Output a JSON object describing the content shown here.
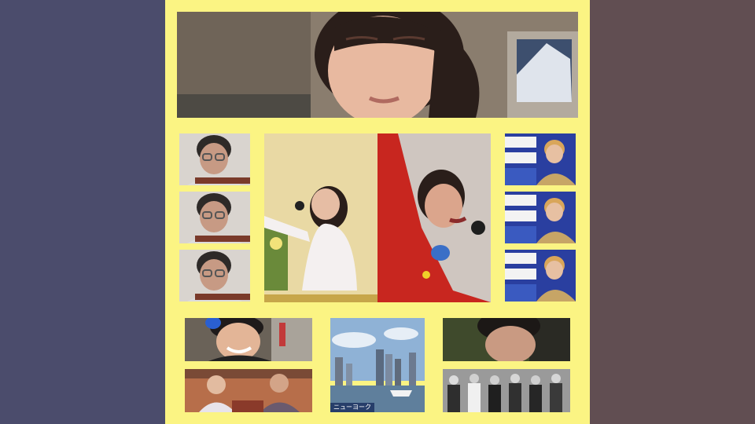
{
  "page": {
    "background_left": "#4b4c6c",
    "background_right": "#614e52",
    "collage_background": "#fbf483"
  },
  "tiles": {
    "banner": {
      "icon": "girl-portrait"
    },
    "left_stack": [
      {
        "icon": "elderly-man-glasses-guitar"
      },
      {
        "icon": "elderly-man-glasses-guitar"
      },
      {
        "icon": "elderly-man-glasses-guitar"
      }
    ],
    "center": {
      "icon": "singers-on-stage"
    },
    "right_stack": [
      {
        "icon": "tv-host-in-studio"
      },
      {
        "icon": "tv-host-in-studio"
      },
      {
        "icon": "tv-host-in-studio"
      }
    ],
    "bottom": [
      {
        "icon": "smiling-young-man"
      },
      {
        "icon": "city-skyline-harbor",
        "caption": "ニューヨーク"
      },
      {
        "icon": "woman-head-outdoors"
      },
      {
        "icon": "men-at-table"
      },
      {
        "icon": "crowd-black-and-white"
      }
    ]
  }
}
